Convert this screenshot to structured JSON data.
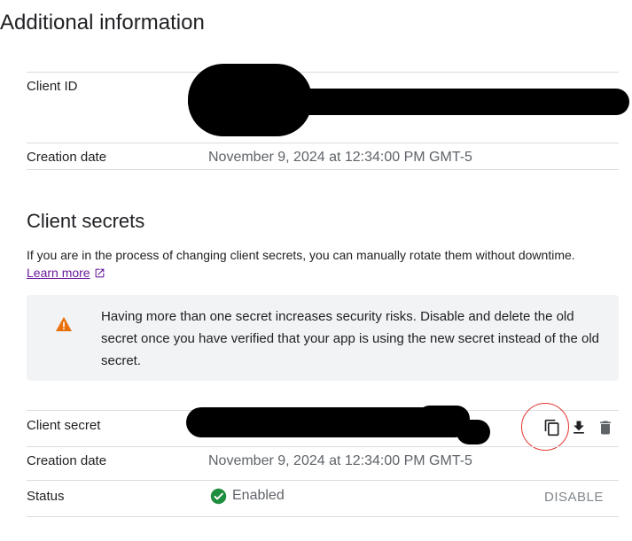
{
  "additional_info": {
    "title": "Additional information",
    "client_id_label": "Client ID",
    "creation_date_label": "Creation date",
    "creation_date_value": "November 9, 2024 at 12:34:00 PM GMT-5"
  },
  "client_secrets": {
    "title": "Client secrets",
    "description": "If you are in the process of changing client secrets, you can manually rotate them without downtime.",
    "learn_more": "Learn more",
    "warning_text": "Having more than one secret increases security risks. Disable and delete the old secret once you have verified that your app is using the new secret instead of the old secret.",
    "secret_label": "Client secret",
    "secret_creation_date_label": "Creation date",
    "secret_creation_date_value": "November 9, 2024 at 12:34:00 PM GMT-5",
    "status_label": "Status",
    "status_value": "Enabled",
    "disable_label": "DISABLE"
  },
  "icons": {
    "copy": "copy-icon",
    "download": "download-icon",
    "delete": "delete-icon",
    "warning": "warning-icon",
    "external": "external-link-icon",
    "check": "check-circle-icon"
  },
  "colors": {
    "warning": "#e8710a",
    "enabled": "#1e8e3e",
    "link": "#6a1b9a",
    "annotation": "#e53935"
  }
}
